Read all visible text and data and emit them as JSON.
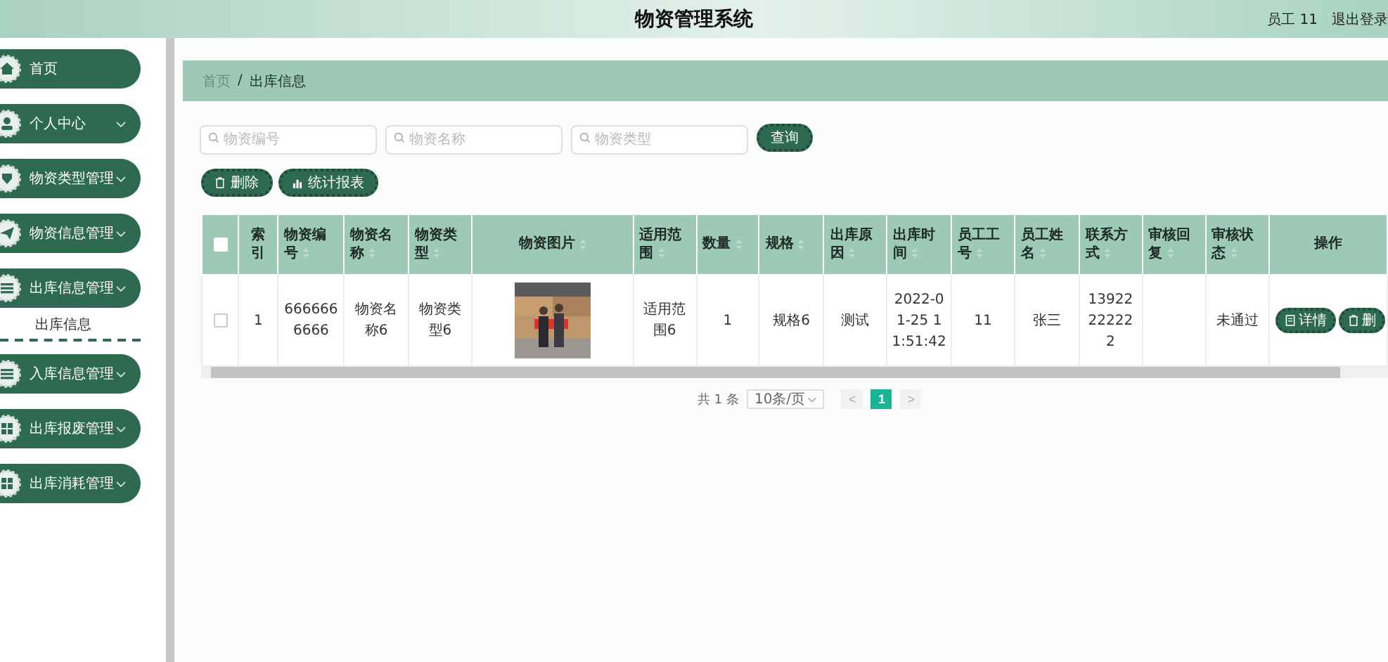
{
  "header": {
    "title": "物资管理系统",
    "user": "员工 11",
    "logout": "退出登录"
  },
  "sidebar": {
    "items": [
      {
        "label": "首页",
        "kind": "link"
      },
      {
        "label": "个人中心",
        "kind": "menu"
      },
      {
        "label": "物资类型管理",
        "kind": "menu"
      },
      {
        "label": "物资信息管理",
        "kind": "menu"
      },
      {
        "label": "出库信息管理",
        "kind": "menu",
        "children": [
          {
            "label": "出库信息",
            "selected": true
          }
        ]
      },
      {
        "label": "入库信息管理",
        "kind": "menu"
      },
      {
        "label": "出库报废管理",
        "kind": "menu"
      },
      {
        "label": "出库消耗管理",
        "kind": "menu"
      }
    ]
  },
  "breadcrumb": [
    "首页",
    "/",
    "出库信息"
  ],
  "search": {
    "fields": [
      {
        "placeholder": "物资编号"
      },
      {
        "placeholder": "物资名称"
      },
      {
        "placeholder": "物资类型"
      }
    ],
    "button": "查询"
  },
  "toolbar": [
    "删除",
    "统计报表"
  ],
  "table": {
    "header_checked": false,
    "columns": [
      {
        "label": "索引",
        "sortable": false
      },
      {
        "label": "物资编号",
        "sortable": true
      },
      {
        "label": "物资名称",
        "sortable": true
      },
      {
        "label": "物资类型",
        "sortable": true
      },
      {
        "label": "物资图片",
        "sortable": true
      },
      {
        "label": "适用范围",
        "sortable": true
      },
      {
        "label": "数量",
        "sortable": true
      },
      {
        "label": "规格",
        "sortable": true
      },
      {
        "label": "出库原因",
        "sortable": true
      },
      {
        "label": "出库时间",
        "sortable": true
      },
      {
        "label": "员工工号",
        "sortable": true
      },
      {
        "label": "员工姓名",
        "sortable": true
      },
      {
        "label": "联系方式",
        "sortable": true
      },
      {
        "label": "审核回复",
        "sortable": true
      },
      {
        "label": "审核状态",
        "sortable": true
      },
      {
        "label": "操作",
        "sortable": false
      }
    ],
    "rows": [
      {
        "checked": false,
        "cells": [
          "1",
          "6666666666",
          "物资名称6",
          "物资类型6",
          {
            "kind": "picture"
          },
          "适用范围6",
          "1",
          "规格6",
          "测试",
          "2022-01-25 11:51:42",
          "11",
          "张三",
          "13922222222",
          "",
          "未通过"
        ],
        "actions": [
          "详情",
          "删"
        ]
      }
    ]
  },
  "pagination": {
    "total": "共 1 条",
    "page_size": "10条/页",
    "prev": "<",
    "next": ">",
    "pages": [
      {
        "label": "1",
        "selected": true
      }
    ]
  }
}
